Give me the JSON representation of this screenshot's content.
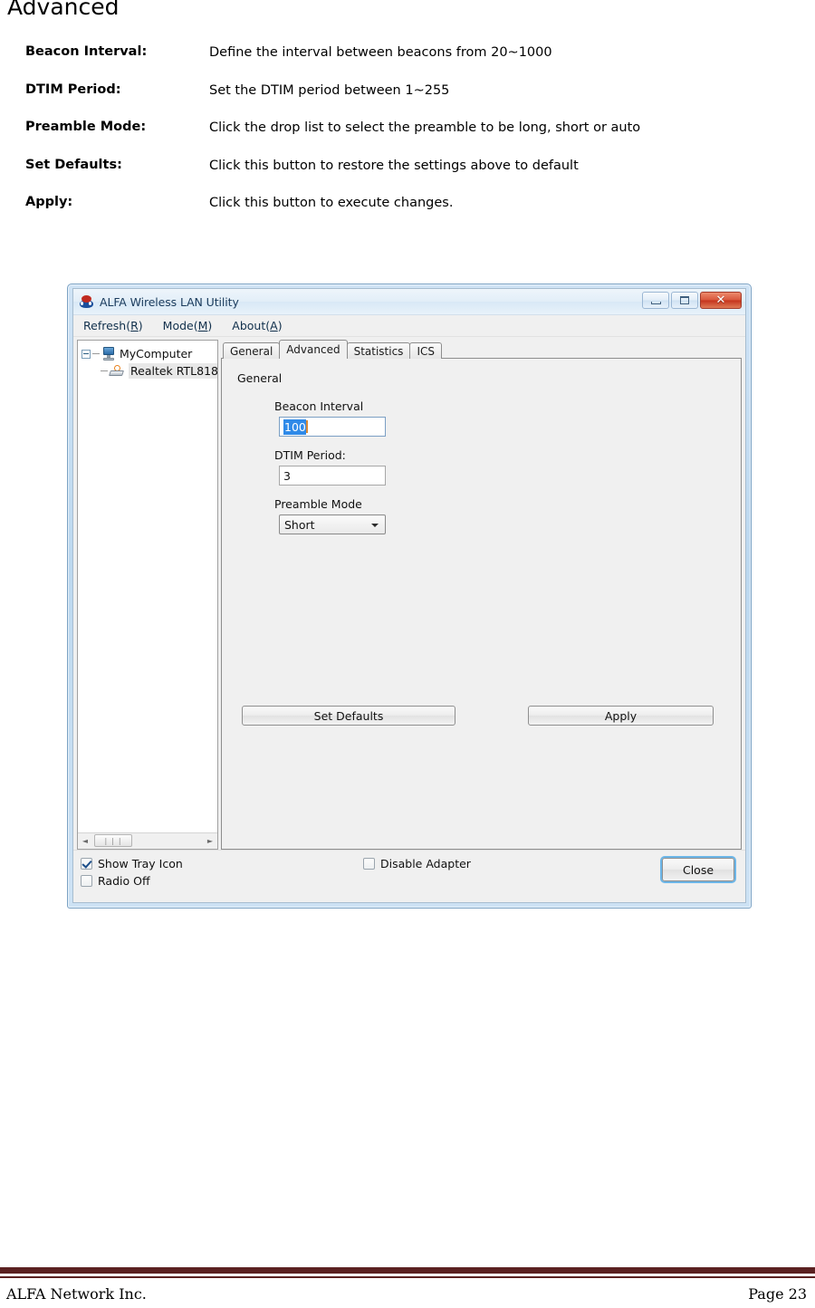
{
  "document": {
    "heading": "Advanced",
    "definitions": [
      {
        "term": "Beacon Interval:",
        "description": "Define the interval between beacons from 20~1000"
      },
      {
        "term": "DTIM Period:",
        "description": "Set the DTIM period between 1~255"
      },
      {
        "term": "Preamble Mode:",
        "description": "Click the drop list to select the preamble to be long, short or auto"
      },
      {
        "term": "Set Defaults:",
        "description": "Click this button to restore the settings above to default"
      },
      {
        "term": "Apply:",
        "description": "Click this button to execute changes."
      }
    ],
    "footer": {
      "company": "ALFA Network Inc.",
      "page": "Page 23",
      "rule_color": "#5b2222"
    }
  },
  "app": {
    "titlebar": {
      "title": "ALFA Wireless LAN Utility",
      "icon": "alfa-logo-icon",
      "minimize_glyph": "minimize-icon",
      "maximize_glyph": "maximize-icon",
      "close_glyph": "✕"
    },
    "menubar": [
      {
        "label_pre": "Refresh(",
        "accel": "R",
        "label_post": ")"
      },
      {
        "label_pre": "Mode(",
        "accel": "M",
        "label_post": ")"
      },
      {
        "label_pre": "About(",
        "accel": "A",
        "label_post": ")"
      }
    ],
    "tree": {
      "root": "MyComputer",
      "child": "Realtek RTL818",
      "scroll_left_arrow": "◄",
      "scroll_right_arrow": "►",
      "thumb_grip": "❘❘❘"
    },
    "tabs": [
      {
        "label": "General",
        "active": false
      },
      {
        "label": "Advanced",
        "active": true
      },
      {
        "label": "Statistics",
        "active": false
      },
      {
        "label": "ICS",
        "active": false
      }
    ],
    "advanced_tab": {
      "group_label": "General",
      "beacon_interval_label": "Beacon Interval",
      "beacon_interval_value": "100",
      "dtim_period_label": "DTIM Period:",
      "dtim_period_value": "3",
      "preamble_mode_label": "Preamble Mode",
      "preamble_mode_value": "Short",
      "set_defaults_button": "Set Defaults",
      "apply_button": "Apply",
      "selection_color": "#2f8ae8",
      "caret_color": "#d98a36"
    },
    "bottom_bar": {
      "show_tray_icon_label": "Show Tray Icon",
      "show_tray_icon_checked": true,
      "radio_off_label": "Radio Off",
      "radio_off_checked": false,
      "disable_adapter_label": "Disable Adapter",
      "disable_adapter_checked": false,
      "close_button": "Close",
      "focus_ring_color": "#6cb6e8"
    }
  }
}
